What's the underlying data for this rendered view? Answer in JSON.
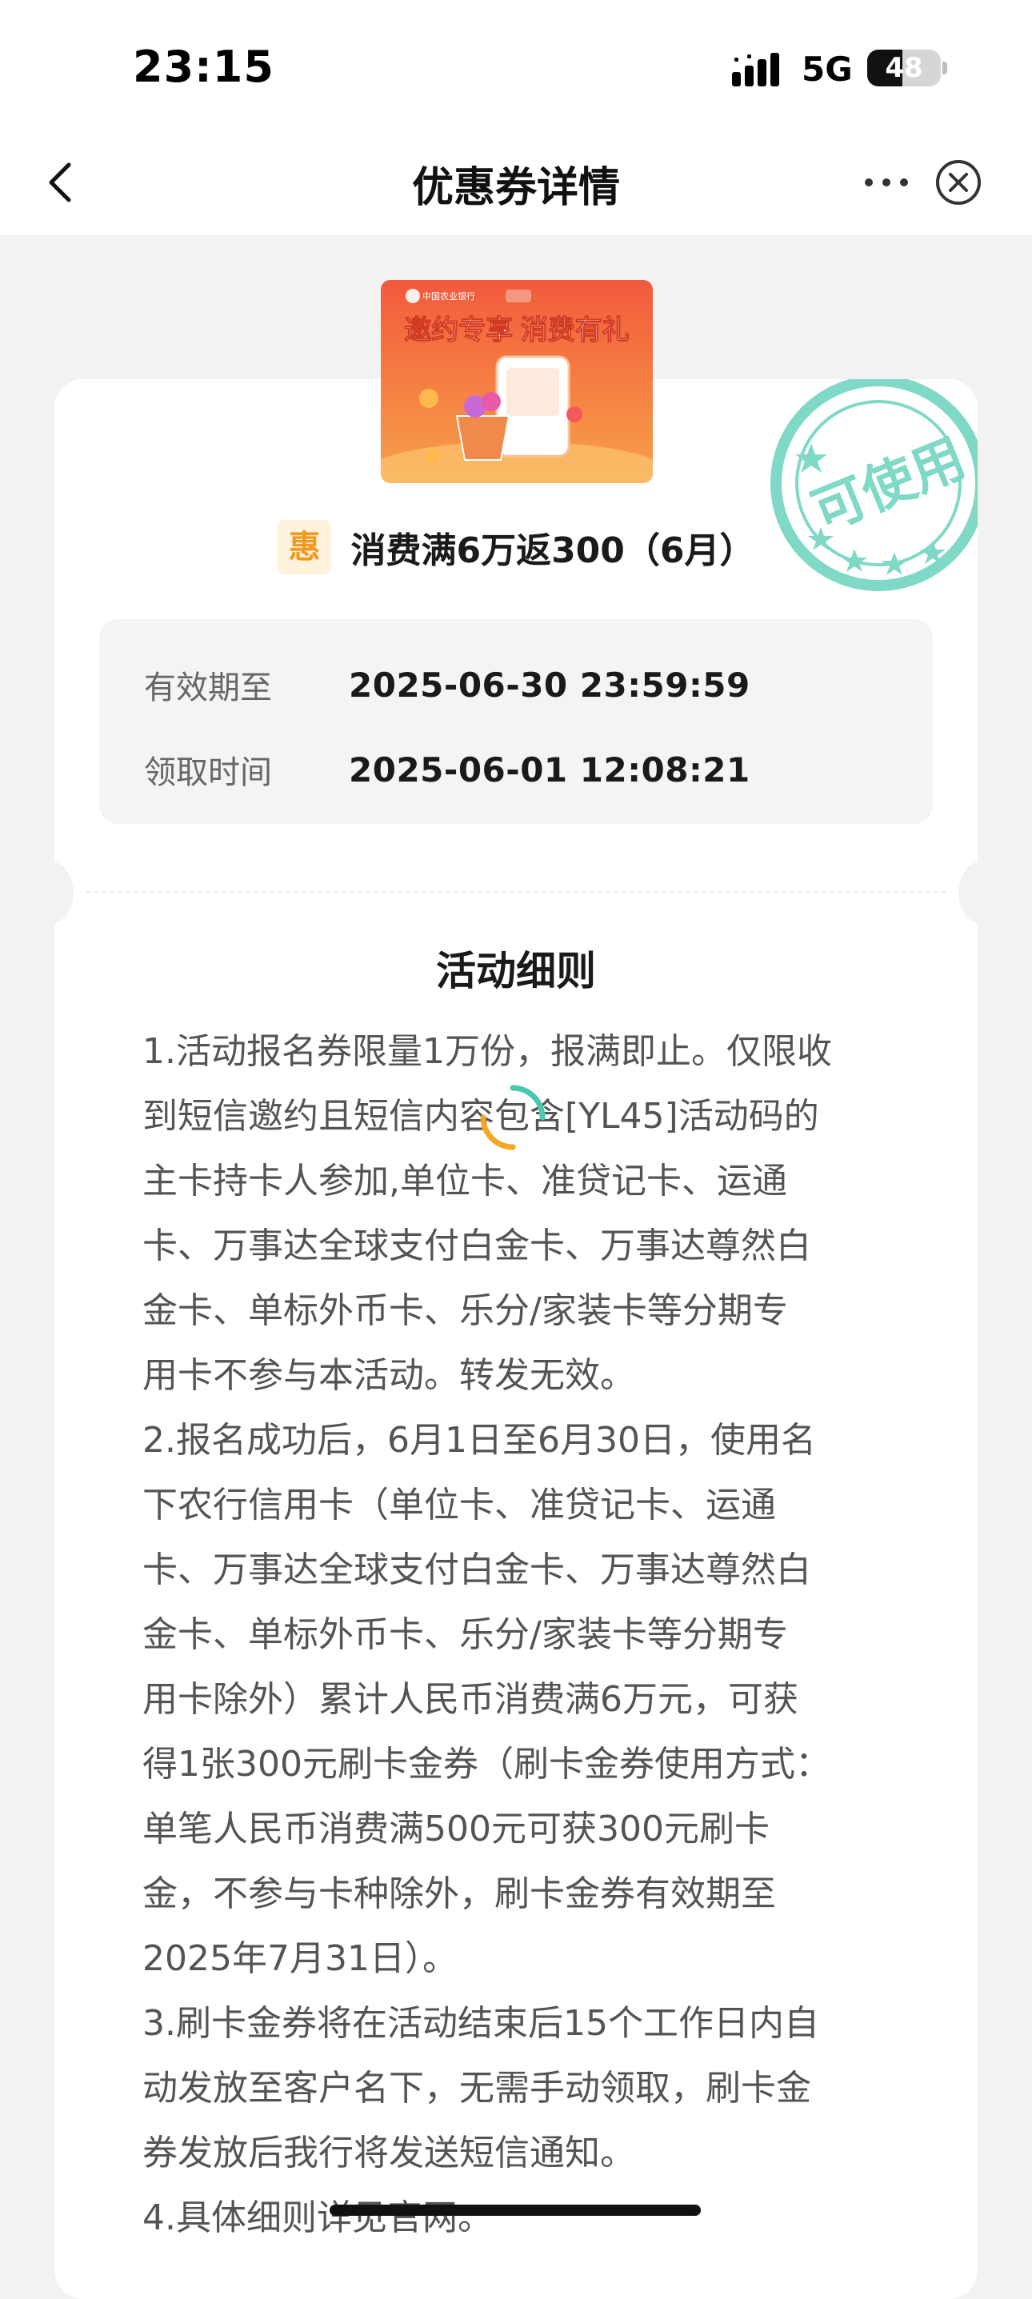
{
  "status_bar": {
    "time": "23:15",
    "network": "5G",
    "battery_level": "48",
    "battery_fraction": 0.48
  },
  "nav": {
    "title": "优惠券详情",
    "back_icon": "chevron-left-icon",
    "more_icon": "more-dots-icon",
    "close_icon": "close-circle-icon"
  },
  "banner": {
    "bank_name": "中国农业银行",
    "headline": "邀约专享 消费有礼"
  },
  "stamp": {
    "text": "可使用",
    "color": "#7fd9c6"
  },
  "coupon": {
    "badge": "惠",
    "title": "消费满6万返300（6月）"
  },
  "info": {
    "valid_until_label": "有效期至",
    "valid_until_value": "2025-06-30 23:59:59",
    "claim_time_label": "领取时间",
    "claim_time_value": "2025-06-01 12:08:21"
  },
  "rules": {
    "title": "活动细则",
    "lines": [
      "1.活动报名券限量1万份，报满即止。仅限收",
      "到短信邀约且短信内容包含[YL45]活动码的",
      "主卡持卡人参加,单位卡、准贷记卡、运通",
      "卡、万事达全球支付白金卡、万事达尊然白",
      "金卡、单标外币卡、乐分/家装卡等分期专",
      "用卡不参与本活动。转发无效。",
      "2.报名成功后，6月1日至6月30日，使用名",
      "下农行信用卡（单位卡、准贷记卡、运通",
      "卡、万事达全球支付白金卡、万事达尊然白",
      "金卡、单标外币卡、乐分/家装卡等分期专",
      "用卡除外）累计人民币消费满6万元，可获",
      "得1张300元刷卡金券（刷卡金券使用方式：",
      "单笔人民币消费满500元可获300元刷卡",
      "金，不参与卡种除外，刷卡金券有效期至",
      "2025年7月31日）。",
      "3.刷卡金券将在活动结束后15个工作日内自",
      "动发放至客户名下，无需手动领取，刷卡金",
      "券发放后我行将发送短信通知。",
      "4.具体细则详见官网。"
    ]
  },
  "colors": {
    "accent_orange": "#f29a1f",
    "banner_red": "#f04b32",
    "stamp_teal": "#7fd9c6",
    "spinner_teal": "#4cc7b0",
    "spinner_orange": "#f5a623"
  }
}
